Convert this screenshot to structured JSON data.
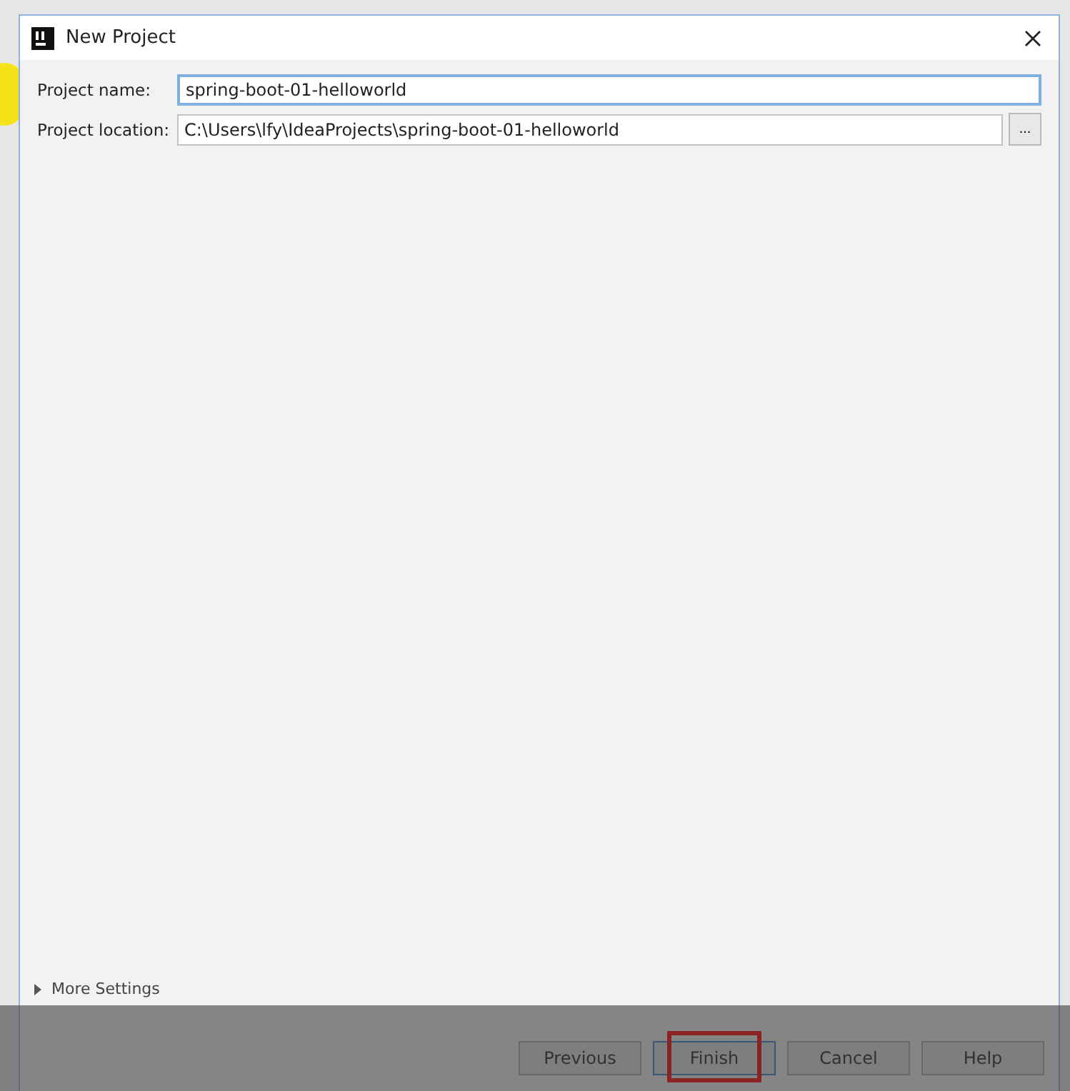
{
  "window": {
    "title": "New Project"
  },
  "fields": [
    {
      "label": "Project name:",
      "value": "spring-boot-01-helloworld",
      "focused": true
    },
    {
      "label": "Project location:",
      "value": "C:\\Users\\lfy\\IdeaProjects\\spring-boot-01-helloworld",
      "focused": false,
      "browse": "..."
    }
  ],
  "more_settings": {
    "label": "More Settings",
    "expanded": false
  },
  "buttons": [
    {
      "label": "Previous",
      "default": false,
      "highlighted": false
    },
    {
      "label": "Finish",
      "default": true,
      "highlighted": true
    },
    {
      "label": "Cancel",
      "default": false,
      "highlighted": false
    },
    {
      "label": "Help",
      "default": false,
      "highlighted": false
    }
  ]
}
